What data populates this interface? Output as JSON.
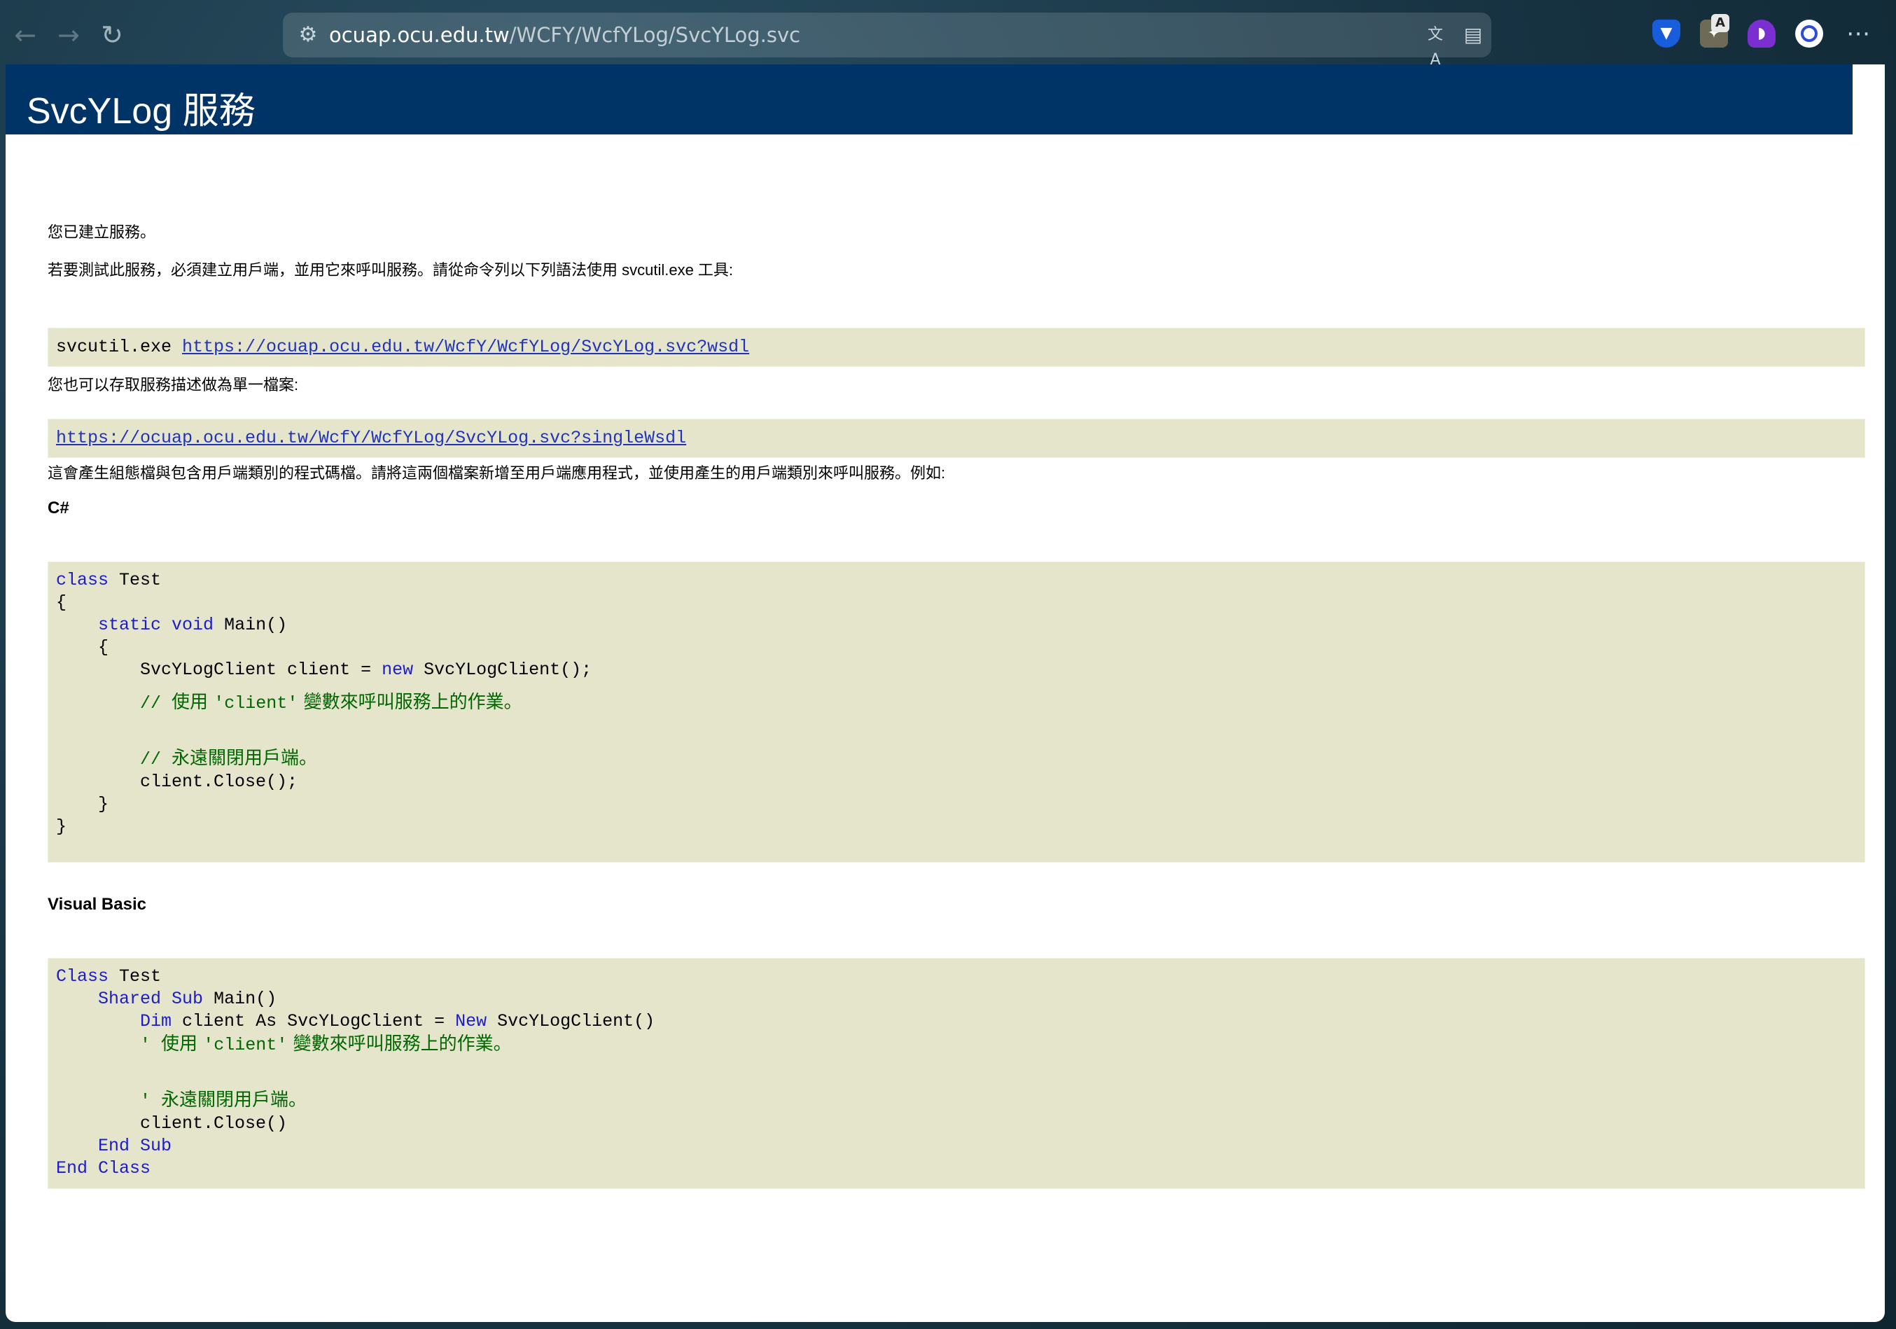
{
  "browser": {
    "back_icon": "←",
    "forward_icon": "→",
    "reload_icon": "↻",
    "url_host": "ocuap.ocu.edu.tw",
    "url_path": "/WCFY/WcfYLog/SvcYLog.svc",
    "translate_icon": "文A",
    "reader_icon": "▤",
    "extension_badge": "A",
    "more_icon": "⋯"
  },
  "page": {
    "title": "SvcYLog 服務",
    "created_text": "您已建立服務。",
    "test_text": "若要測試此服務，必須建立用戶端，並用它來呼叫服務。請從命令列以下列語法使用 svcutil.exe 工具:",
    "svcutil_cmd": "svcutil.exe ",
    "wsdl_url": "https://ocuap.ocu.edu.tw/WcfY/WcfYLog/SvcYLog.svc?wsdl",
    "single_text": "您也可以存取服務描述做為單一檔案:",
    "single_wsdl_url": "https://ocuap.ocu.edu.tw/WcfY/WcfYLog/SvcYLog.svc?singleWsdl",
    "generate_text": "這會產生組態檔與包含用戶端類別的程式碼檔。請將這兩個檔案新增至用戶端應用程式，並使用產生的用戶端類別來呼叫服務。例如:",
    "csharp_title": "C#",
    "vb_title": "Visual Basic"
  },
  "csharp": {
    "kw_class": "class",
    "class_name": " Test",
    "open1": "{",
    "indent1": "    ",
    "kw_static": "static",
    "kw_void": "void",
    "main_sig": " Main()",
    "open2": "    {",
    "decl_pre": "        SvcYLogClient client = ",
    "kw_new": "new",
    "decl_post": " SvcYLogClient();",
    "comment1_pre": "        // ",
    "comment1_a": "使用 ",
    "comment1_b": "'client'",
    "comment1_c": " 變數來呼叫服務上的作業。",
    "comment2_pre": "        // ",
    "comment2_a": "永遠關閉用戶端。",
    "close_call": "        client.Close();",
    "close2": "    }",
    "close1": "}"
  },
  "vb": {
    "kw_class": "Class",
    "class_name": " Test",
    "indent1": "    ",
    "kw_shared": "Shared",
    "kw_sub": "Sub",
    "main_sig": " Main()",
    "indent2": "        ",
    "kw_dim": "Dim",
    "dim_mid": " client As SvcYLogClient = ",
    "kw_new": "New",
    "dim_post": " SvcYLogClient()",
    "comment1_pre": "        ' ",
    "comment1_a": "使用 ",
    "comment1_b": "'client'",
    "comment1_c": " 變數來呼叫服務上的作業。",
    "comment2_pre": "        ' ",
    "comment2_a": "永遠關閉用戶端。",
    "close_call": "        client.Close()",
    "kw_end": "End",
    "kw_end_sub": "Sub",
    "kw_end2": "End",
    "kw_end_class": "Class"
  }
}
